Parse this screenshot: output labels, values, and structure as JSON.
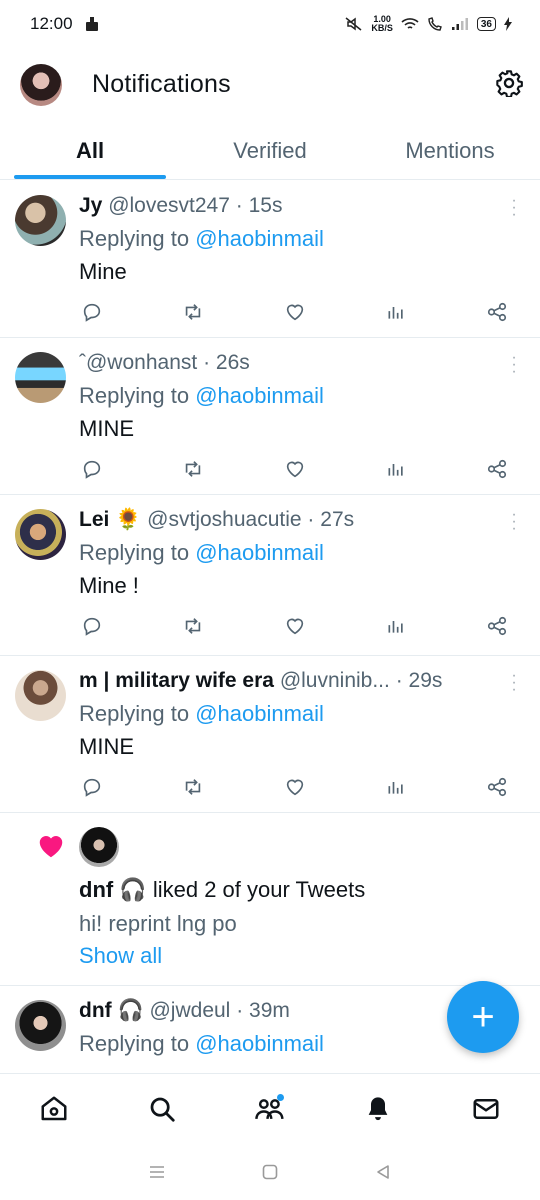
{
  "status_bar": {
    "time": "12:00",
    "net_speed_value": "1.00",
    "net_speed_unit": "KB/S",
    "battery": "36"
  },
  "header": {
    "title": "Notifications"
  },
  "tabs": [
    {
      "label": "All",
      "active": true
    },
    {
      "label": "Verified",
      "active": false
    },
    {
      "label": "Mentions",
      "active": false
    }
  ],
  "tweets": [
    {
      "name": "Jy",
      "handle": "@lovesvt247",
      "time": "15s",
      "reply_prefix": "Replying to",
      "reply_to": "@haobinmail",
      "text": "Mine"
    },
    {
      "name": "",
      "handle": "ˆ@wonhanst",
      "time": "26s",
      "reply_prefix": "Replying to",
      "reply_to": "@haobinmail",
      "text": "MINE"
    },
    {
      "name": "Lei 🌻",
      "handle": "@svtjoshuacutie",
      "time": "27s",
      "reply_prefix": "Replying to",
      "reply_to": "@haobinmail",
      "text": "Mine !"
    },
    {
      "name": "m | military wife era",
      "handle": "@luvninib...",
      "time": "29s",
      "reply_prefix": "Replying to",
      "reply_to": "@haobinmail",
      "text": "MINE"
    }
  ],
  "liked_notification": {
    "name": "dnf 🎧",
    "action": "liked 2 of your Tweets",
    "preview": "hi! reprint lng po",
    "show_all": "Show all"
  },
  "partial_tweet": {
    "name": "dnf 🎧",
    "handle": "@jwdeul",
    "time": "39m",
    "reply_prefix": "Replying to",
    "reply_to": "@haobinmail"
  },
  "fab": {
    "label": "+"
  },
  "colors": {
    "accent": "#1d9bf0",
    "like": "#f91880",
    "secondary_text": "#536471",
    "divider": "#e6ecf0"
  }
}
